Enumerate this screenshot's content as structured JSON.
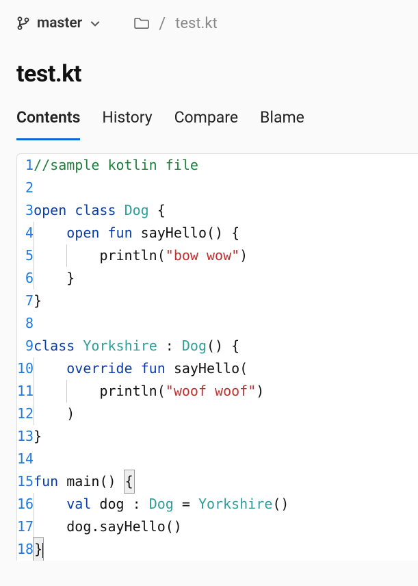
{
  "branch": {
    "name": "master"
  },
  "breadcrumb": {
    "file": "test.kt"
  },
  "title": "test.kt",
  "tabs": [
    {
      "label": "Contents",
      "active": true
    },
    {
      "label": "History",
      "active": false
    },
    {
      "label": "Compare",
      "active": false
    },
    {
      "label": "Blame",
      "active": false
    }
  ],
  "code": {
    "lines": [
      {
        "num": 1,
        "tokens": [
          {
            "t": "//sample kotlin file",
            "c": "c-comment"
          }
        ]
      },
      {
        "num": 2,
        "tokens": []
      },
      {
        "num": 3,
        "tokens": [
          {
            "t": "open",
            "c": "c-keyword"
          },
          {
            "t": " "
          },
          {
            "t": "class",
            "c": "c-keyword"
          },
          {
            "t": " "
          },
          {
            "t": "Dog",
            "c": "c-type"
          },
          {
            "t": " { "
          }
        ]
      },
      {
        "num": 4,
        "guides": [
          0
        ],
        "indent": "    ",
        "tokens": [
          {
            "t": "open",
            "c": "c-keyword"
          },
          {
            "t": " "
          },
          {
            "t": "fun",
            "c": "c-keyword"
          },
          {
            "t": " "
          },
          {
            "t": "sayHello",
            "c": "c-func"
          },
          {
            "t": "()"
          },
          {
            "t": " { "
          }
        ]
      },
      {
        "num": 5,
        "guides": [
          0,
          1
        ],
        "indent": "        ",
        "tokens": [
          {
            "t": "println",
            "c": "c-func"
          },
          {
            "t": "("
          },
          {
            "t": "\"bow wow\"",
            "c": "c-string"
          },
          {
            "t": ")"
          }
        ]
      },
      {
        "num": 6,
        "guides": [
          0
        ],
        "indent": "    ",
        "tokens": [
          {
            "t": "}"
          }
        ]
      },
      {
        "num": 7,
        "tokens": [
          {
            "t": "}"
          }
        ]
      },
      {
        "num": 8,
        "tokens": []
      },
      {
        "num": 9,
        "tokens": [
          {
            "t": "class",
            "c": "c-keyword"
          },
          {
            "t": " "
          },
          {
            "t": "Yorkshire",
            "c": "c-type"
          },
          {
            "t": " : "
          },
          {
            "t": "Dog",
            "c": "c-type"
          },
          {
            "t": "()"
          },
          {
            "t": " { "
          }
        ]
      },
      {
        "num": 10,
        "guides": [
          0
        ],
        "indent": "    ",
        "tokens": [
          {
            "t": "override",
            "c": "c-keyword"
          },
          {
            "t": " "
          },
          {
            "t": "fun",
            "c": "c-keyword"
          },
          {
            "t": " "
          },
          {
            "t": "sayHello",
            "c": "c-func"
          },
          {
            "t": "("
          }
        ]
      },
      {
        "num": 11,
        "guides": [
          0,
          1
        ],
        "indent": "        ",
        "tokens": [
          {
            "t": "println",
            "c": "c-func"
          },
          {
            "t": "("
          },
          {
            "t": "\"woof woof\"",
            "c": "c-string"
          },
          {
            "t": ")"
          }
        ]
      },
      {
        "num": 12,
        "guides": [
          0
        ],
        "indent": "    ",
        "tokens": [
          {
            "t": ")"
          }
        ]
      },
      {
        "num": 13,
        "tokens": [
          {
            "t": "}"
          }
        ]
      },
      {
        "num": 14,
        "tokens": []
      },
      {
        "num": 15,
        "tokens": [
          {
            "t": "fun",
            "c": "c-keyword"
          },
          {
            "t": " "
          },
          {
            "t": "main",
            "c": "c-func"
          },
          {
            "t": "()"
          },
          {
            "t": " "
          },
          {
            "t": "{",
            "c": "",
            "box": true
          }
        ]
      },
      {
        "num": 16,
        "guides": [
          0
        ],
        "indent": "    ",
        "tokens": [
          {
            "t": "val",
            "c": "c-keyword"
          },
          {
            "t": " dog : "
          },
          {
            "t": "Dog",
            "c": "c-type"
          },
          {
            "t": " = "
          },
          {
            "t": "Yorkshire",
            "c": "c-type"
          },
          {
            "t": "()"
          }
        ]
      },
      {
        "num": 17,
        "guides": [
          0
        ],
        "indent": "    ",
        "tokens": [
          {
            "t": "dog.sayHello",
            "c": "c-func"
          },
          {
            "t": "()"
          }
        ]
      },
      {
        "num": 18,
        "tokens": [
          {
            "t": "}",
            "c": "",
            "box": true
          },
          {
            "t": "",
            "cursor": true
          }
        ]
      }
    ]
  }
}
